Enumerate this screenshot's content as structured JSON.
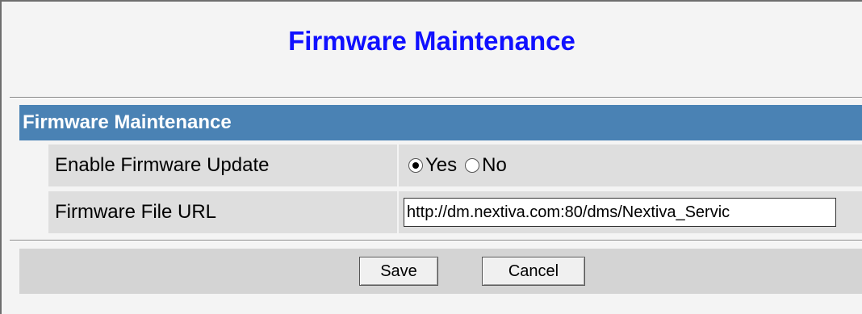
{
  "page": {
    "title": "Firmware Maintenance"
  },
  "section": {
    "title": "Firmware Maintenance"
  },
  "fields": {
    "enable_update": {
      "label": "Enable Firmware Update",
      "options": [
        "Yes",
        "No"
      ],
      "selected": "Yes"
    },
    "file_url": {
      "label": "Firmware File URL",
      "value": "http://dm.nextiva.com:80/dms/Nextiva_Servic"
    }
  },
  "buttons": {
    "save": "Save",
    "cancel": "Cancel"
  },
  "colors": {
    "title": "#1010ff",
    "header": "#4a82b4"
  }
}
